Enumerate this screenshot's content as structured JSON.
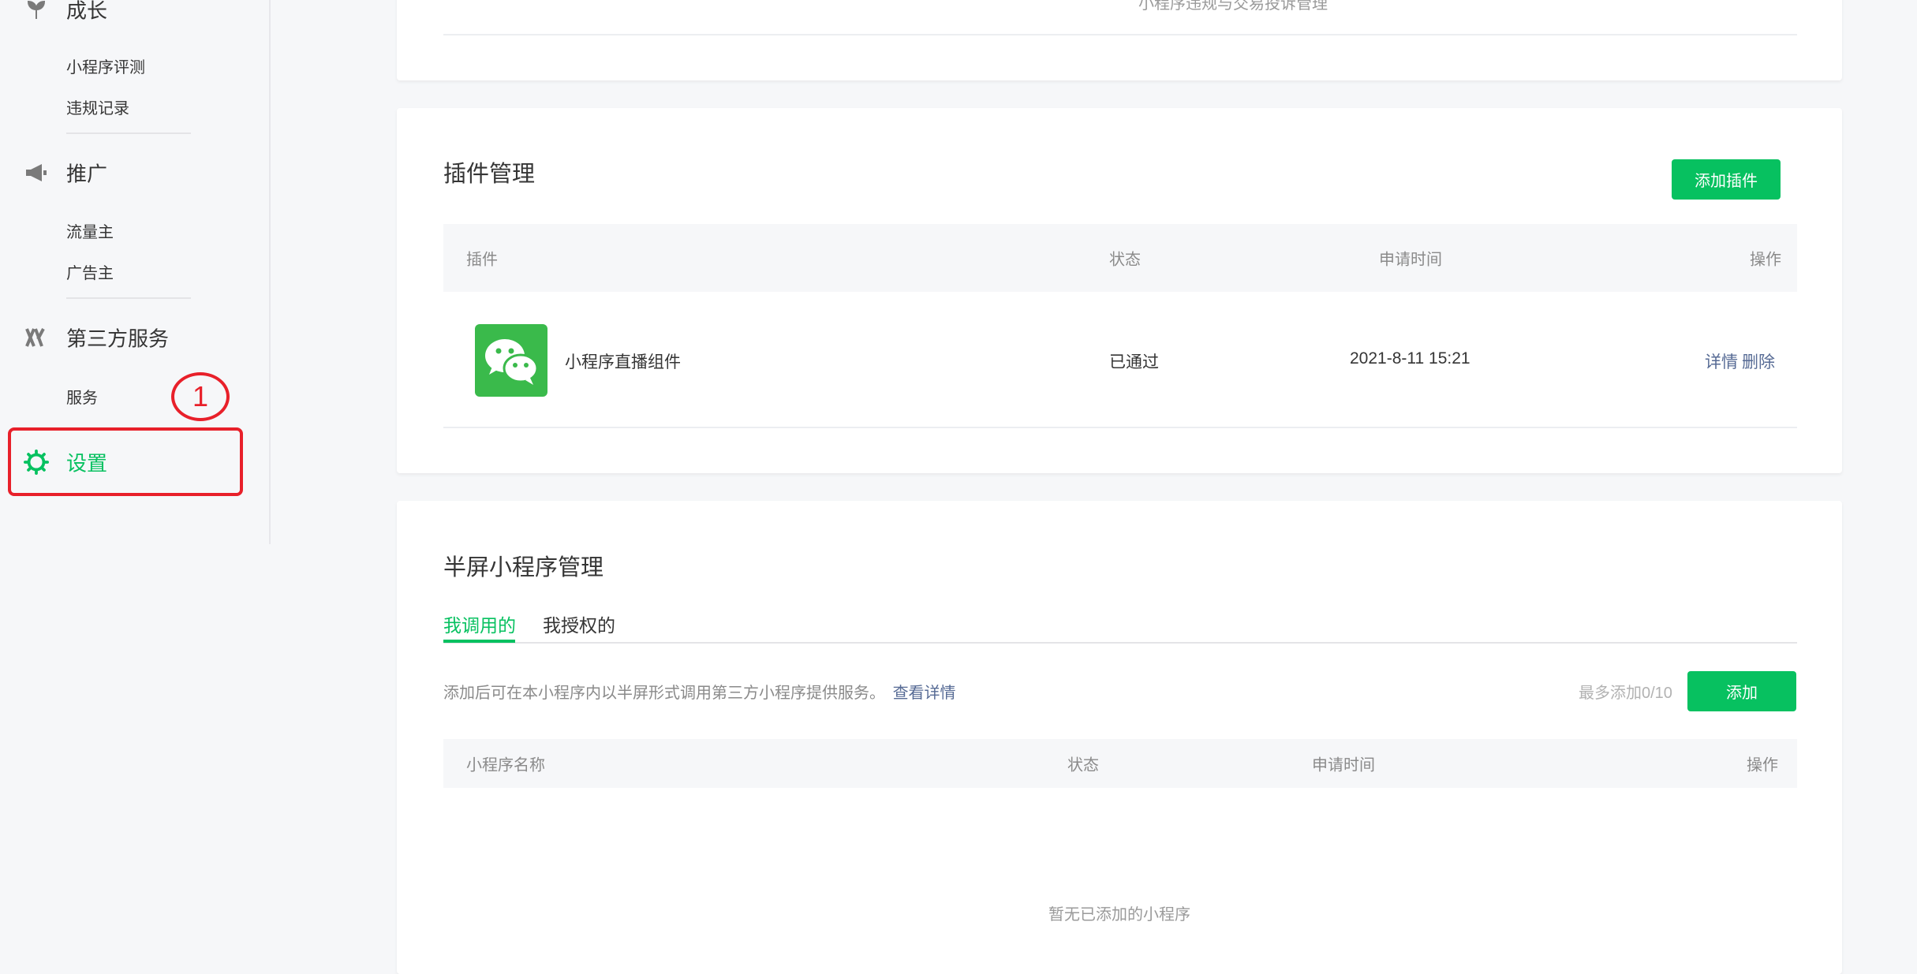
{
  "sidebar": {
    "growth": {
      "label": "成长",
      "icon": "leaf-icon",
      "items": [
        "小程序评测",
        "违规记录"
      ]
    },
    "promotion": {
      "label": "推广",
      "icon": "megaphone-icon",
      "items": [
        "流量主",
        "广告主"
      ]
    },
    "third_party": {
      "label": "第三方服务",
      "icon": "third-party-icon",
      "items": [
        "服务"
      ]
    },
    "settings": {
      "label": "设置",
      "icon": "gear-icon",
      "active": true
    },
    "annotation_marker": "1"
  },
  "top_card": {
    "cut_text": "小程序违规与交易投诉管理"
  },
  "plugin_card": {
    "title": "插件管理",
    "add_button": "添加插件",
    "columns": {
      "plugin": "插件",
      "status": "状态",
      "apply_time": "申请时间",
      "actions": "操作"
    },
    "rows": [
      {
        "name": "小程序直播组件",
        "status": "已通过",
        "apply_time": "2021-8-11 15:21",
        "detail": "详情",
        "delete": "删除",
        "icon": "wechat-icon"
      }
    ]
  },
  "half_screen_card": {
    "title": "半屏小程序管理",
    "tabs": [
      "我调用的",
      "我授权的"
    ],
    "active_tab": 0,
    "description": "添加后可在本小程序内以半屏形式调用第三方小程序提供服务。",
    "details_link": "查看详情",
    "limit_text": "最多添加0/10",
    "add_button": "添加",
    "columns": {
      "name": "小程序名称",
      "status": "状态",
      "apply_time": "申请时间",
      "actions": "操作"
    },
    "empty_text": "暂无已添加的小程序"
  },
  "colors": {
    "accent": "#07c160",
    "link": "#576b95",
    "annotation": "#e8202a"
  }
}
